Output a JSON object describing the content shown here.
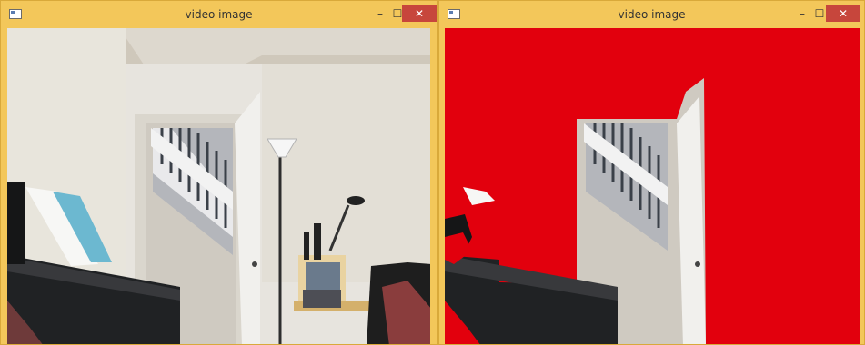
{
  "windows": [
    {
      "title": "video image",
      "controls": {
        "minimize": "–",
        "maximize": "☐",
        "close": "✕"
      },
      "icon": "app-window-icon",
      "content": "camera frame"
    },
    {
      "title": "video image",
      "controls": {
        "minimize": "–",
        "maximize": "☐",
        "close": "✕"
      },
      "icon": "app-window-icon",
      "content": "camera frame with red mask overlay",
      "mask_color": "#e2000d"
    }
  ]
}
